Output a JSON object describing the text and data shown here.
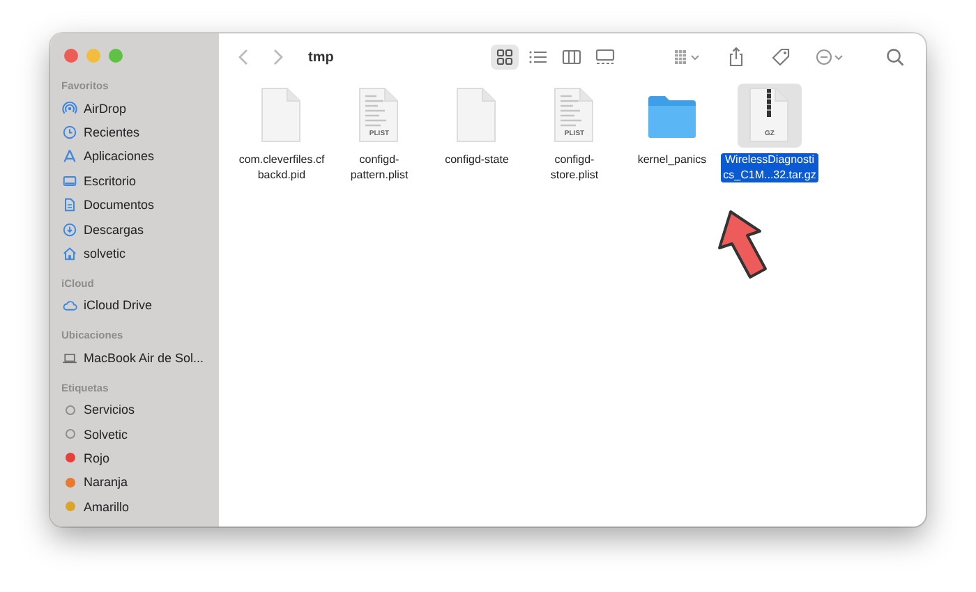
{
  "window": {
    "title": "tmp"
  },
  "sidebar": {
    "sections": [
      {
        "heading": "Favoritos",
        "items": [
          {
            "label": "AirDrop"
          },
          {
            "label": "Recientes"
          },
          {
            "label": "Aplicaciones"
          },
          {
            "label": "Escritorio"
          },
          {
            "label": "Documentos"
          },
          {
            "label": "Descargas"
          },
          {
            "label": "solvetic"
          }
        ]
      },
      {
        "heading": "iCloud",
        "items": [
          {
            "label": "iCloud Drive"
          }
        ]
      },
      {
        "heading": "Ubicaciones",
        "items": [
          {
            "label": "MacBook Air de Sol..."
          }
        ]
      },
      {
        "heading": "Etiquetas",
        "items": [
          {
            "label": "Servicios",
            "color": "#8e8e8e",
            "filled": false
          },
          {
            "label": "Solvetic",
            "color": "#8e8e8e",
            "filled": false
          },
          {
            "label": "Rojo",
            "color": "#e5403a",
            "filled": true
          },
          {
            "label": "Naranja",
            "color": "#e77a2f",
            "filled": true
          },
          {
            "label": "Amarillo",
            "color": "#d9a52a",
            "filled": true
          }
        ]
      }
    ]
  },
  "toolbar": {
    "views": [
      {
        "selected": true
      },
      {
        "selected": false
      },
      {
        "selected": false
      },
      {
        "selected": false
      }
    ]
  },
  "files": [
    {
      "kind": "document",
      "lines": [
        "com.cleverfiles.cf",
        "backd.pid"
      ],
      "selected": false
    },
    {
      "kind": "plist",
      "badge": "PLIST",
      "lines": [
        "configd-",
        "pattern.plist"
      ],
      "selected": false
    },
    {
      "kind": "document",
      "lines": [
        "configd-state"
      ],
      "selected": false
    },
    {
      "kind": "plist",
      "badge": "PLIST",
      "lines": [
        "configd-",
        "store.plist"
      ],
      "selected": false
    },
    {
      "kind": "folder",
      "lines": [
        "kernel_panics"
      ],
      "selected": false
    },
    {
      "kind": "archive",
      "badge": "GZ",
      "lines": [
        "WirelessDiagnosti",
        "cs_C1M...32.tar.gz"
      ],
      "selected": true
    }
  ],
  "annotation": {
    "kind": "arrow"
  }
}
